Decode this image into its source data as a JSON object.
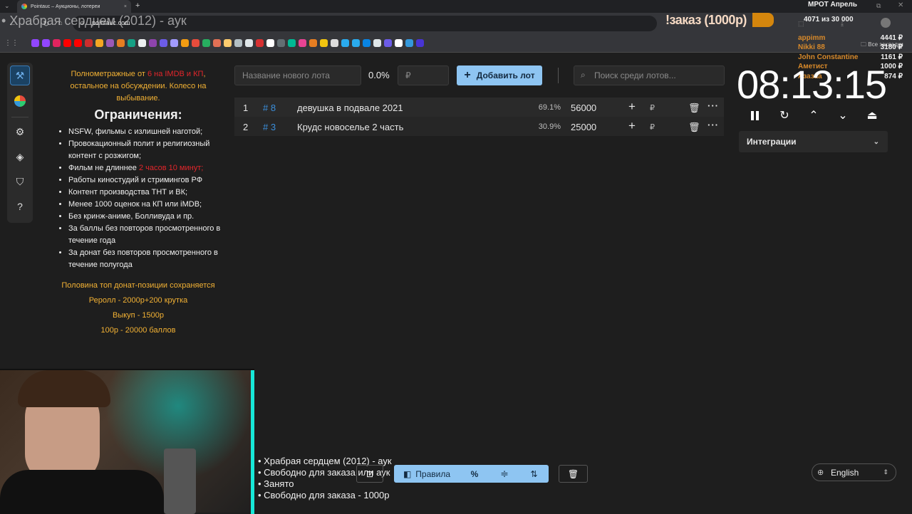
{
  "browser": {
    "tab_title": "Pointauc – Аукционы, лотереи",
    "url": "pointauc.com",
    "bookmarks_label": "Все закладки"
  },
  "overlay": {
    "title": "Храбрая сердцем (2012) - аук",
    "order_label": "!заказ (1000р)",
    "goal_title": "МРОТ Апрель",
    "goal_progress": "4071  из 30 000",
    "donors": [
      {
        "name": "appimm",
        "amount": "4441 ₽"
      },
      {
        "name": "Nikki 88",
        "amount": "3180 ₽"
      },
      {
        "name": "John Constantine",
        "amount": "1161 ₽"
      },
      {
        "name": "Аметист",
        "amount": "1000 ₽"
      },
      {
        "name": "Азазаа",
        "amount": "874 ₽"
      }
    ]
  },
  "rules": {
    "intro_prefix": "Полнометражные от ",
    "intro_highlight": "6 на IMDB и КП",
    "intro_suffix": ", остальное на обсуждении. Колесо на выбывание.",
    "heading": "Ограничения:",
    "items": [
      {
        "text": "NSFW, фильмы с излишней наготой;"
      },
      {
        "text": "Провокационный полит и религиозный контент с розжигом;"
      },
      {
        "text": "Фильм не длиннее ",
        "highlight": "2 часов 10 минут;"
      },
      {
        "text": "Работы киностудий и стримингов РФ"
      },
      {
        "text": "Контент производства ТНТ и ВК;"
      },
      {
        "text": "Менее 1000 оценок на КП или iMDB;"
      },
      {
        "text": "Без кринж-аниме, Болливуда и пр."
      },
      {
        "text": "За баллы без повторов просмотренного в течение года"
      },
      {
        "text": "За донат без повторов просмотренного в течение полугода"
      }
    ],
    "footer": [
      "Половина топ донат-позиции сохраняется",
      "Реролл - 2000р+200 крутка",
      "Выкуп - 1500р",
      "100р - 20000 баллов"
    ]
  },
  "lot_form": {
    "name_placeholder": "Название нового лота",
    "percent": "0.0%",
    "amount_placeholder": "₽",
    "add_label": "Добавить лот",
    "search_placeholder": "Поиск среди лотов..."
  },
  "lots": [
    {
      "index": "1",
      "id": "# 8",
      "name": "девушка в подвале 2021",
      "percent": "69.1%",
      "amount": "56000",
      "currency": "₽"
    },
    {
      "index": "2",
      "id": "# 3",
      "name": "Крудс новоселье 2 часть",
      "percent": "30.9%",
      "amount": "25000",
      "currency": "₽"
    }
  ],
  "timer": {
    "value": "08:13:15"
  },
  "integrations": {
    "label": "Интеграции"
  },
  "status_list": [
    "• Храбрая сердцем (2012) - аук",
    "• Свободно для заказа или аук",
    "• Занято",
    "• Свободно для заказа - 1000р"
  ],
  "toolbar": {
    "rules_label": "Правила",
    "percent_symbol": "%"
  },
  "language": {
    "selected": "English"
  },
  "colors": {
    "accent_blue": "#8ec5f2",
    "lot_id_blue": "#3b8fdc",
    "highlight_red": "#e3262b",
    "highlight_orange": "#f2b134",
    "donor_orange": "#d7892a"
  }
}
